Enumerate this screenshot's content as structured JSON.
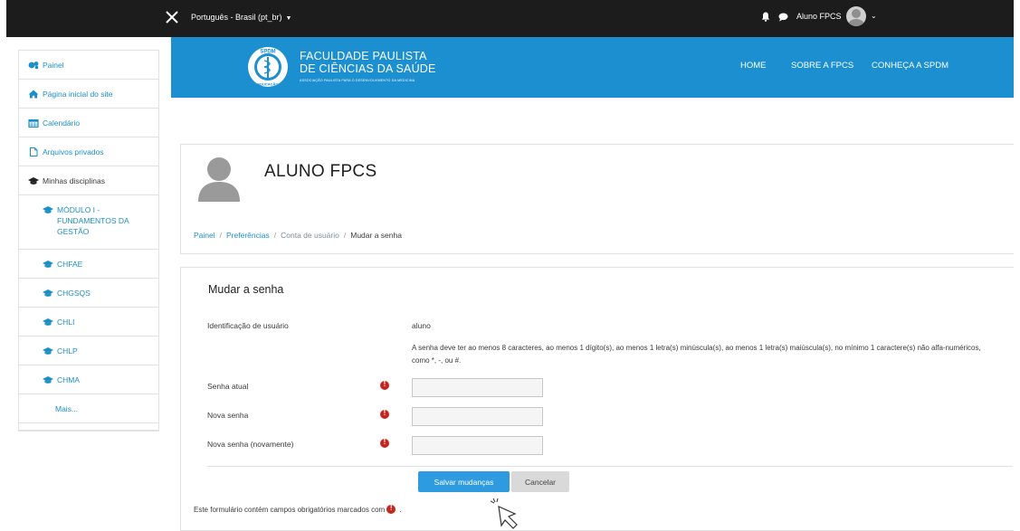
{
  "topbar": {
    "language": "Português - Brasil (pt_br)",
    "user_name": "Aluno FPCS"
  },
  "sidebar": {
    "items": [
      {
        "label": "Painel",
        "icon": "dashboard-icon"
      },
      {
        "label": "Página inicial do site",
        "icon": "home-icon"
      },
      {
        "label": "Calendário",
        "icon": "calendar-icon"
      },
      {
        "label": "Arquivos privados",
        "icon": "file-icon"
      },
      {
        "label": "Minhas disciplinas",
        "icon": "graduation-cap-icon"
      },
      {
        "label": "MÓDULO I - FUNDAMENTOS DA GESTÃO",
        "icon": "graduation-cap-icon"
      },
      {
        "label": "CHFAE",
        "icon": "graduation-cap-icon"
      },
      {
        "label": "CHGSQS",
        "icon": "graduation-cap-icon"
      },
      {
        "label": "CHLI",
        "icon": "graduation-cap-icon"
      },
      {
        "label": "CHLP",
        "icon": "graduation-cap-icon"
      },
      {
        "label": "CHMA",
        "icon": "graduation-cap-icon"
      },
      {
        "label": "Mais...",
        "icon": ""
      }
    ]
  },
  "brand": {
    "line1": "FACULDADE PAULISTA",
    "line2": "DE CIÊNCIAS DA SAÚDE",
    "tagline": "ASSOCIAÇÃO PAULISTA PARA O DESENVOLVIMENTO DA MEDICINA",
    "logo_top": "SPDM",
    "logo_bottom": "EDUCAÇÃO",
    "nav": [
      "HOME",
      "SOBRE A FPCS",
      "CONHEÇA A SPDM"
    ],
    "color": "#1b8fd0"
  },
  "profile": {
    "name": "ALUNO FPCS",
    "breadcrumb": [
      "Painel",
      "Preferências",
      "Conta de usuário",
      "Mudar a senha"
    ]
  },
  "form": {
    "title": "Mudar a senha",
    "username_label": "Identificação de usuário",
    "username_value": "aluno",
    "rule_text": "A senha deve ter ao menos 8 caracteres, ao menos 1 dígito(s), ao menos 1 letra(s) minúscula(s), ao menos 1 letra(s) maiúscula(s), no mínimo 1 caractere(s) não alfa-numéricos, como *, -, ou #.",
    "fields": [
      {
        "label": "Senha atual",
        "value": ""
      },
      {
        "label": "Nova senha",
        "value": ""
      },
      {
        "label": "Nova senha (novamente)",
        "value": ""
      }
    ],
    "save_label": "Salvar mudanças",
    "cancel_label": "Cancelar",
    "required_note": "Este formulário contém campos obrigatórios marcados com",
    "required_color": "#c3271f",
    "save_color": "#2e9be0"
  }
}
